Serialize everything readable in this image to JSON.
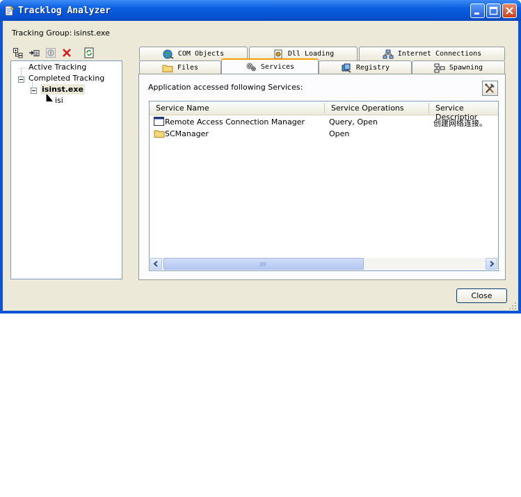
{
  "window": {
    "title": "Tracklog Analyzer"
  },
  "tracking_group": {
    "label": "Tracking Group:",
    "value": "isinst.exe"
  },
  "toolbar": {
    "icons": [
      "tree-view-icon",
      "move-to-list-icon",
      "stop-icon",
      "delete-icon",
      "refresh-icon"
    ]
  },
  "tree": {
    "nodes": [
      {
        "label": "Active Tracking"
      },
      {
        "label": "Completed Tracking"
      },
      {
        "label": "isinst.exe"
      },
      {
        "label": "isi"
      }
    ]
  },
  "tabs": {
    "row1": [
      {
        "label": "COM Objects",
        "icon": "globe-icon"
      },
      {
        "label": "Dll Loading",
        "icon": "dll-icon"
      },
      {
        "label": "Internet Connections",
        "icon": "network-icon"
      }
    ],
    "row2": [
      {
        "label": "Files",
        "icon": "folder-icon"
      },
      {
        "label": "Services",
        "icon": "gears-icon"
      },
      {
        "label": "Registry",
        "icon": "registry-icon"
      },
      {
        "label": "Spawning",
        "icon": "spawning-icon"
      }
    ]
  },
  "services_panel": {
    "description": "Application accessed following Services:",
    "tools_icon": "tools-icon",
    "columns": [
      "Service Name",
      "Service Operations",
      "Service Descriptior"
    ],
    "rows": [
      {
        "name": "Remote Access Connection Manager",
        "operations": "Query, Open",
        "description": "创建网络连接。",
        "icon": "window-icon"
      },
      {
        "name": "SCManager",
        "operations": "Open",
        "description": "",
        "icon": "folder-icon"
      }
    ]
  },
  "footer": {
    "close_label": "Close"
  },
  "colors": {
    "titlebar": "#0a5ee0",
    "client": "#ece9d8",
    "tab_highlight": "#ff9d00"
  }
}
